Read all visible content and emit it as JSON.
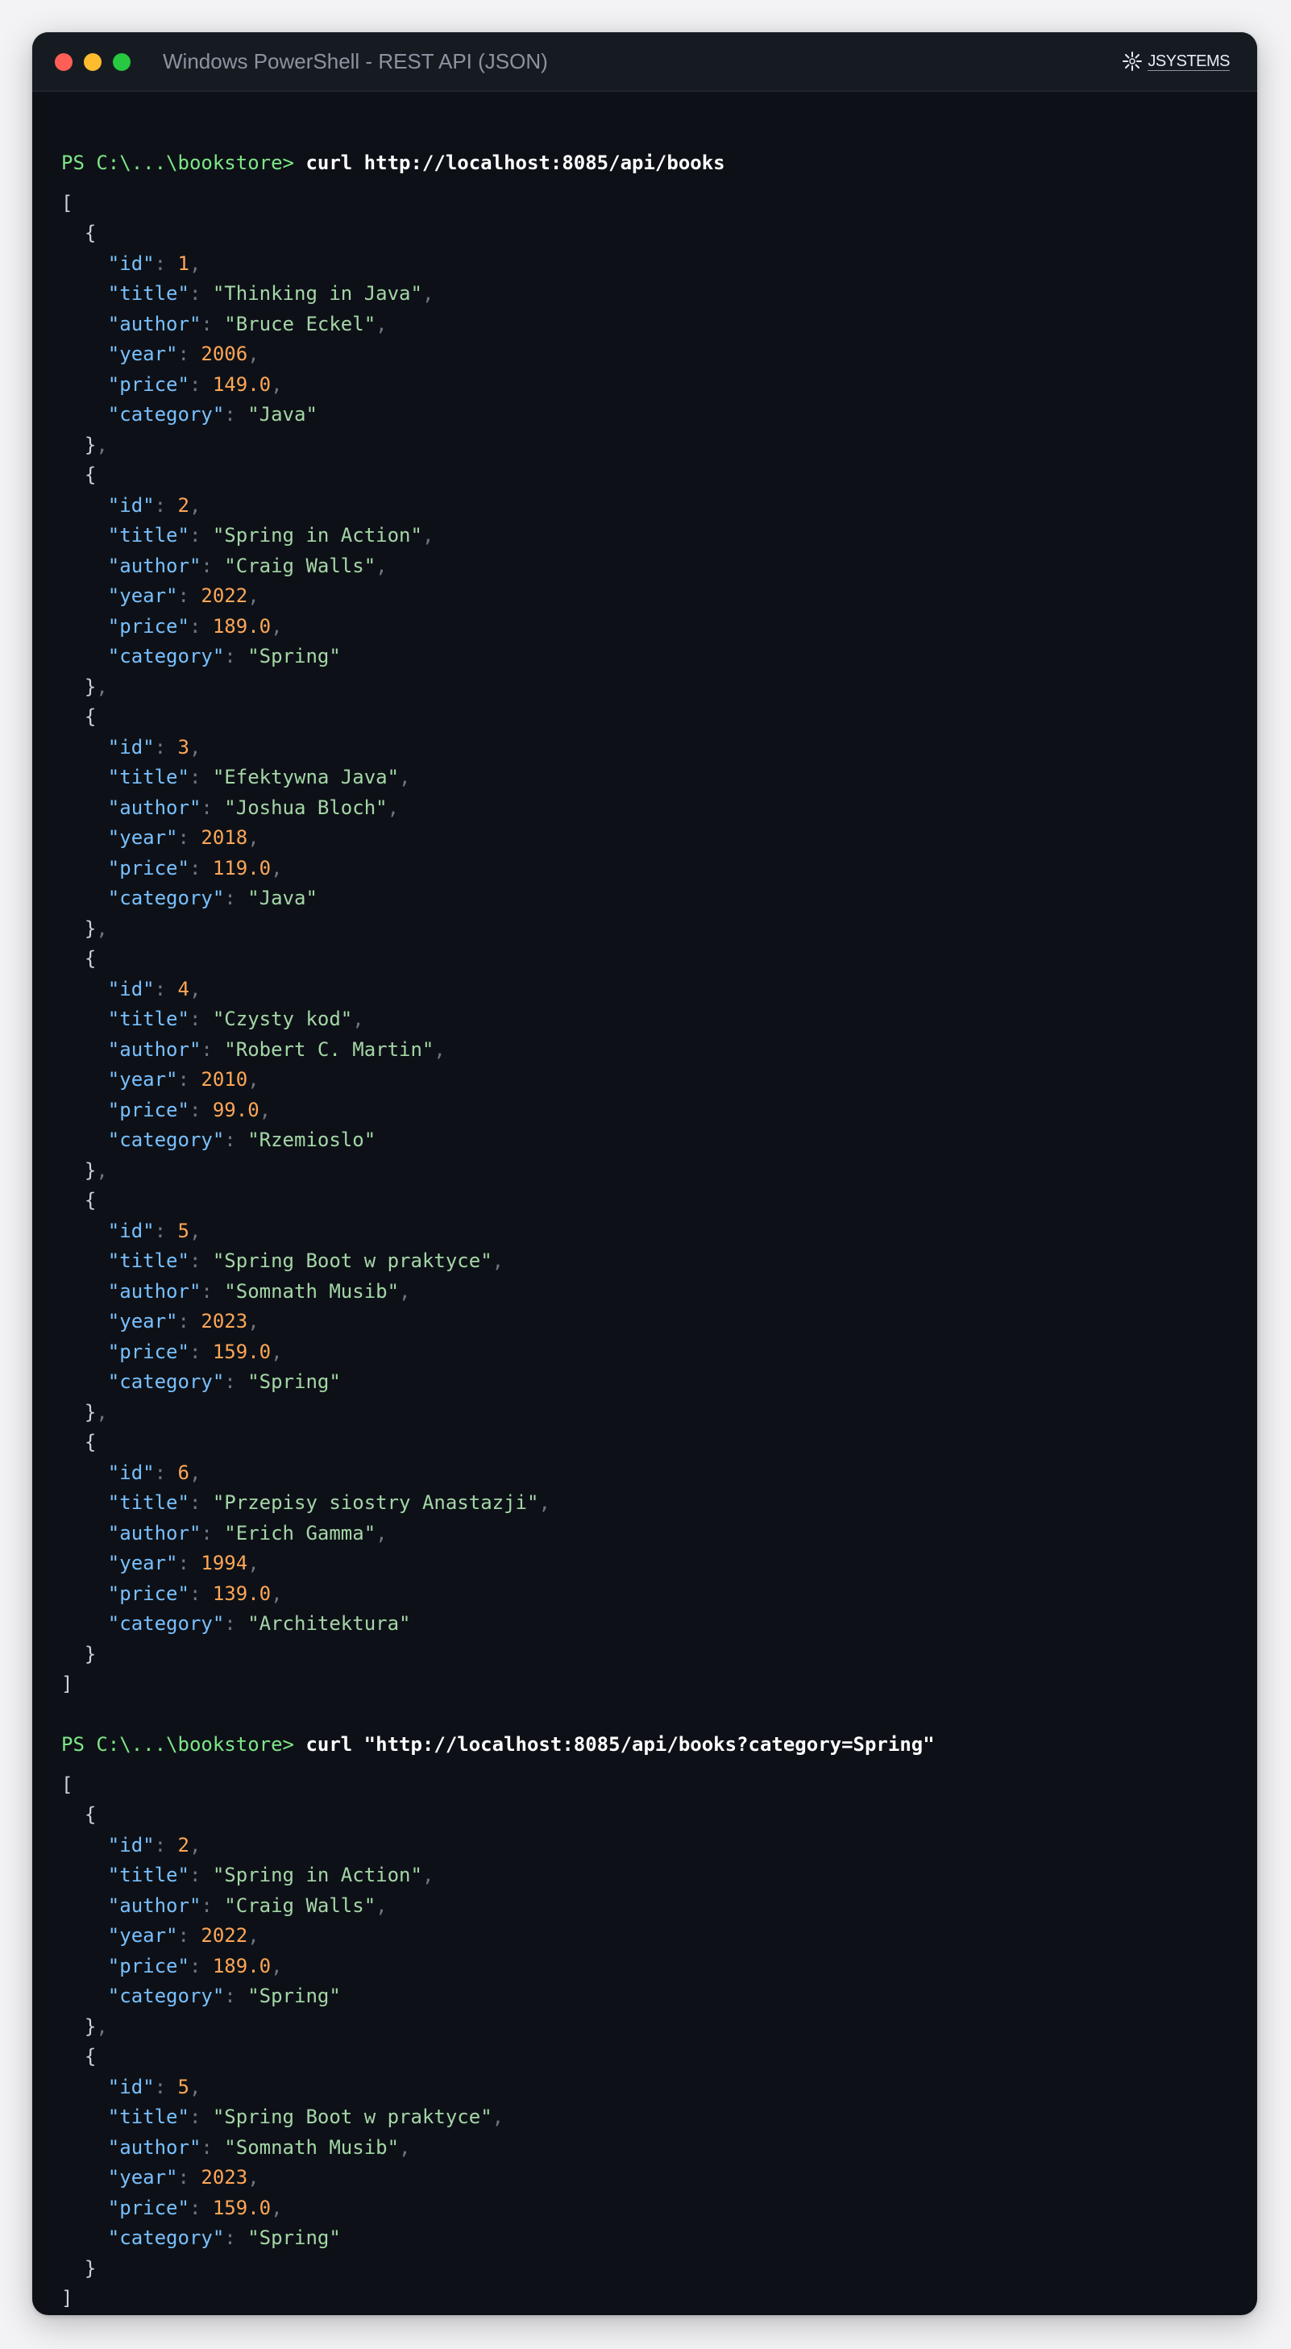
{
  "window": {
    "title": "Windows PowerShell - REST API (JSON)",
    "logo_text": "JSYSTEMS",
    "colors": {
      "close": "#ff5f57",
      "minimize": "#febc2e",
      "maximize": "#28c840",
      "background": "#0d1117",
      "key": "#79c0ff",
      "string": "#a5d6a7",
      "number": "#ffa657",
      "prompt": "#7ee787"
    }
  },
  "sessions": [
    {
      "prompt": "PS C:\\...\\bookstore>",
      "command": "curl http://localhost:8085/api/books",
      "books": [
        {
          "id": "1",
          "title": "\"Thinking in Java\"",
          "author": "\"Bruce Eckel\"",
          "year": "2006",
          "price": "149.0",
          "category": "\"Java\""
        },
        {
          "id": "2",
          "title": "\"Spring in Action\"",
          "author": "\"Craig Walls\"",
          "year": "2022",
          "price": "189.0",
          "category": "\"Spring\""
        },
        {
          "id": "3",
          "title": "\"Efektywna Java\"",
          "author": "\"Joshua Bloch\"",
          "year": "2018",
          "price": "119.0",
          "category": "\"Java\""
        },
        {
          "id": "4",
          "title": "\"Czysty kod\"",
          "author": "\"Robert C. Martin\"",
          "year": "2010",
          "price": "99.0",
          "category": "\"Rzemioslo\""
        },
        {
          "id": "5",
          "title": "\"Spring Boot w praktyce\"",
          "author": "\"Somnath Musib\"",
          "year": "2023",
          "price": "159.0",
          "category": "\"Spring\""
        },
        {
          "id": "6",
          "title": "\"Przepisy siostry Anastazji\"",
          "author": "\"Erich Gamma\"",
          "year": "1994",
          "price": "139.0",
          "category": "\"Architektura\""
        }
      ]
    },
    {
      "prompt": "PS C:\\...\\bookstore>",
      "command": "curl \"http://localhost:8085/api/books?category=Spring\"",
      "books": [
        {
          "id": "2",
          "title": "\"Spring in Action\"",
          "author": "\"Craig Walls\"",
          "year": "2022",
          "price": "189.0",
          "category": "\"Spring\""
        },
        {
          "id": "5",
          "title": "\"Spring Boot w praktyce\"",
          "author": "\"Somnath Musib\"",
          "year": "2023",
          "price": "159.0",
          "category": "\"Spring\""
        }
      ]
    }
  ],
  "json_keys": {
    "id": "\"id\"",
    "title": "\"title\"",
    "author": "\"author\"",
    "year": "\"year\"",
    "price": "\"price\"",
    "category": "\"category\""
  },
  "punct": {
    "open_array": "[",
    "close_array": "]",
    "open_obj": "{",
    "close_obj": "}",
    "comma": ",",
    "colon": ": "
  }
}
